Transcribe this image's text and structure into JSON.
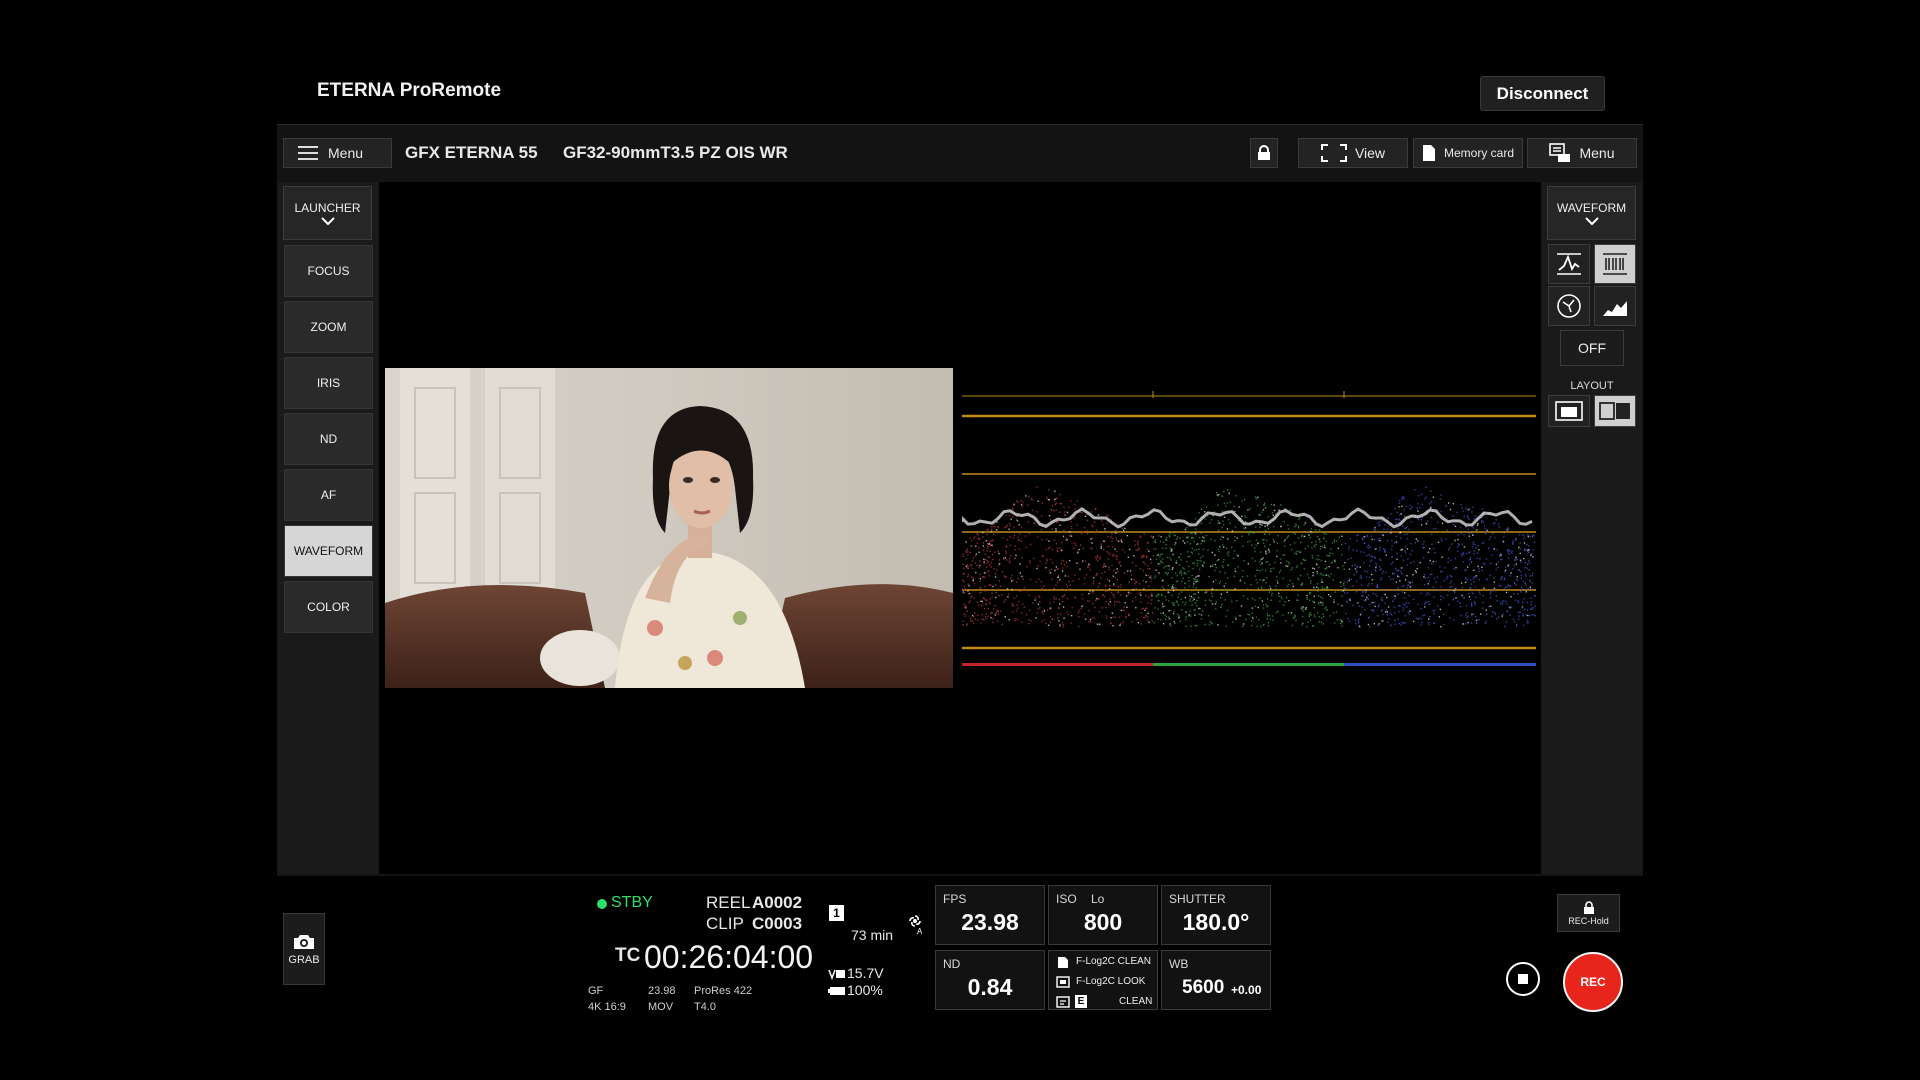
{
  "app": {
    "title": "ETERNA ProRemote",
    "disconnect_label": "Disconnect"
  },
  "toolbar": {
    "menu_label": "Menu",
    "camera_model": "GFX ETERNA 55",
    "lens": "GF32-90mmT3.5 PZ OIS WR",
    "view_label": "View",
    "memory_card_label": "Memory card",
    "menu2_label": "Menu"
  },
  "left_panel": {
    "launcher_label": "LAUNCHER",
    "items": [
      {
        "label": "FOCUS",
        "active": false
      },
      {
        "label": "ZOOM",
        "active": false
      },
      {
        "label": "IRIS",
        "active": false
      },
      {
        "label": "ND",
        "active": false
      },
      {
        "label": "AF",
        "active": false
      },
      {
        "label": "WAVEFORM",
        "active": true
      },
      {
        "label": "COLOR",
        "active": false
      }
    ]
  },
  "right_panel": {
    "mode_label": "WAVEFORM",
    "off_label": "OFF",
    "layout_label": "LAYOUT"
  },
  "status": {
    "state": "STBY",
    "state_color": "#2ee06a",
    "reel_label": "REEL",
    "reel_value": "A0002",
    "clip_label": "CLIP",
    "clip_value": "C0003",
    "tc_label": "TC",
    "timecode": "00:26:04:00",
    "slot": "1",
    "remaining": "73 min",
    "format_line1_col1": "GF",
    "format_line1_col2": "23.98",
    "format_line1_col3": "ProRes 422",
    "format_line2_col1": "4K 16:9",
    "format_line2_col2": "MOV",
    "format_line2_col3": "T4.0",
    "voltage": "15.7V",
    "battery": "100%"
  },
  "params": {
    "fps_label": "FPS",
    "fps_value": "23.98",
    "iso_label": "ISO",
    "iso_sub": "Lo",
    "iso_value": "800",
    "shutter_label": "SHUTTER",
    "shutter_value": "180.0°",
    "nd_label": "ND",
    "nd_value": "0.84",
    "look_line1": "F-Log2C CLEAN",
    "look_line2": "F-Log2C LOOK",
    "look_line3_badge": "E",
    "look_line3": "CLEAN",
    "wb_label": "WB",
    "wb_value": "5600",
    "wb_offset": "+0.00"
  },
  "grab_label": "GRAB",
  "rec_hold_label": "REC-Hold",
  "rec_label": "REC",
  "colors": {
    "rec": "#e8251d",
    "waveform_grid": "#c08a1e",
    "accent_green": "#2ee06a"
  }
}
